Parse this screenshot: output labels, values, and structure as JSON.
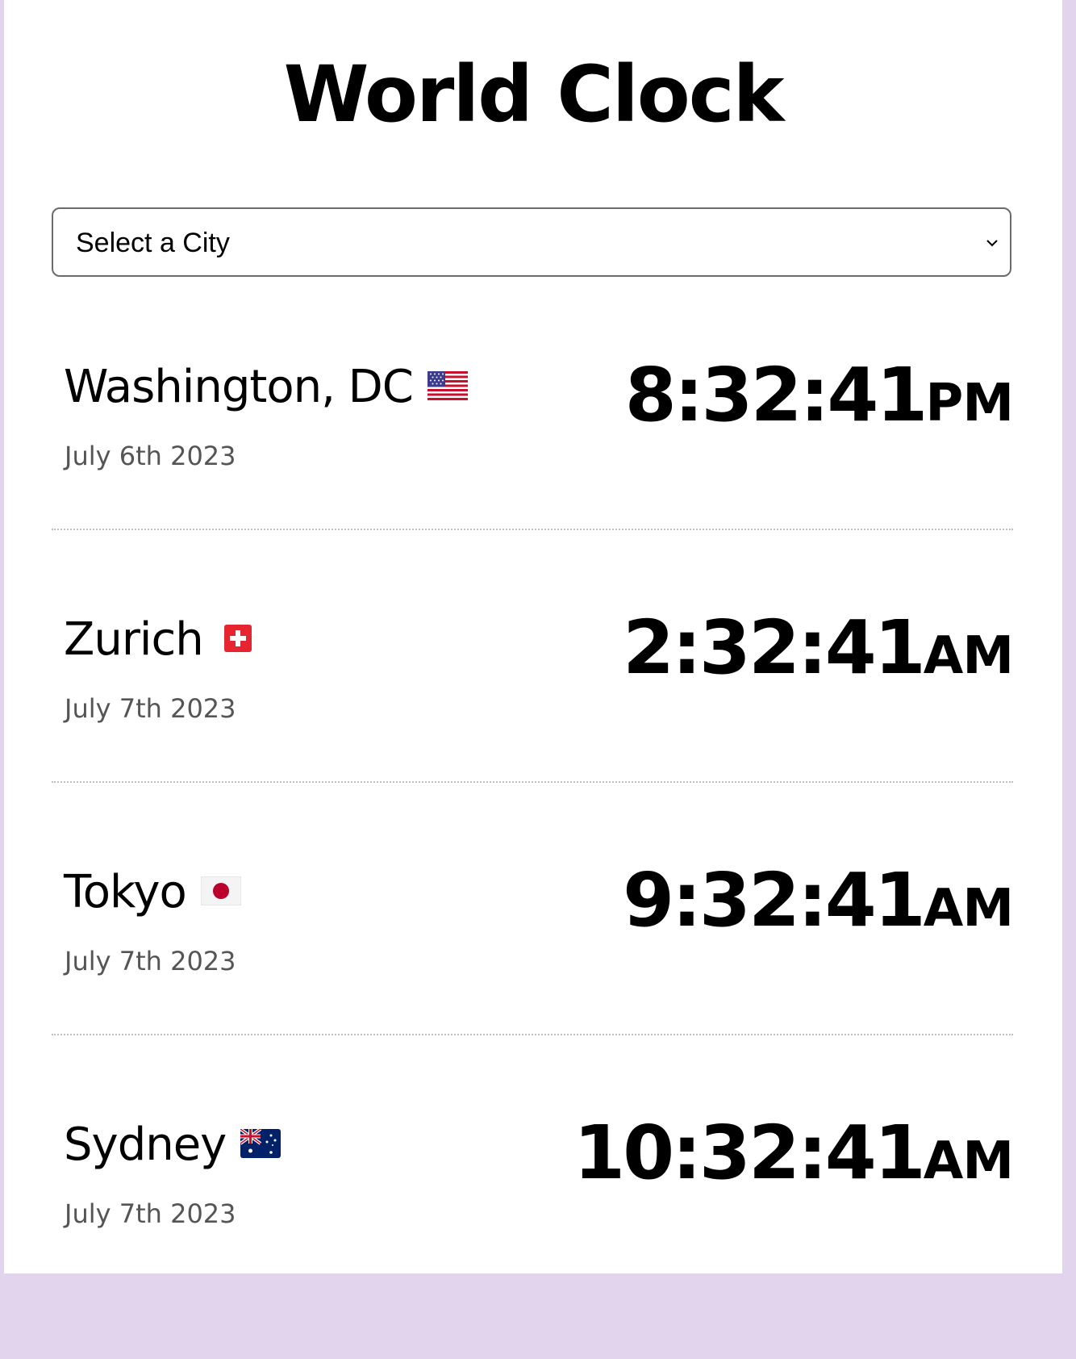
{
  "page": {
    "title": "World Clock"
  },
  "select": {
    "label": "Select a City"
  },
  "cities": [
    {
      "name": "Washington, DC",
      "flag": "us-flag-icon",
      "date": "July 6th 2023",
      "time": "8:32:41",
      "ampm": "PM"
    },
    {
      "name": "Zurich",
      "flag": "ch-flag-icon",
      "date": "July 7th 2023",
      "time": "2:32:41",
      "ampm": "AM"
    },
    {
      "name": "Tokyo",
      "flag": "jp-flag-icon",
      "date": "July 7th 2023",
      "time": "9:32:41",
      "ampm": "AM"
    },
    {
      "name": "Sydney",
      "flag": "au-flag-icon",
      "date": "July 7th 2023",
      "time": "10:32:41",
      "ampm": "AM"
    }
  ],
  "colors": {
    "background_border": "#e3d4ee",
    "date_text": "#555555",
    "divider": "#bfbfbf"
  }
}
